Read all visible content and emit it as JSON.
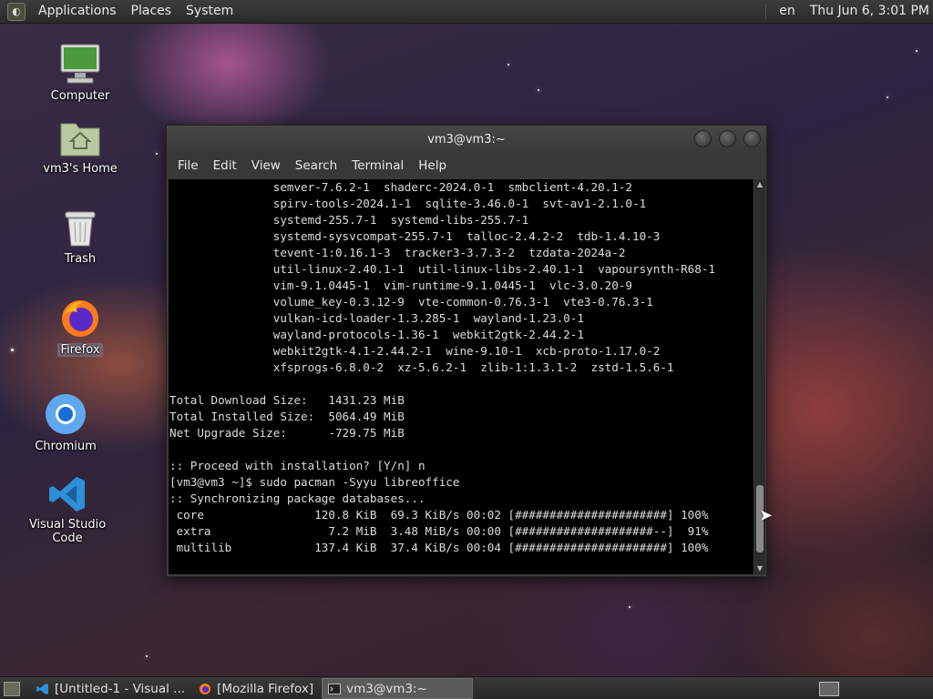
{
  "top_panel": {
    "menus": [
      "Applications",
      "Places",
      "System"
    ],
    "keyboard_layout": "en",
    "clock": "Thu Jun  6,  3:01 PM"
  },
  "desktop": {
    "icons": [
      {
        "label": "Computer",
        "icon": "computer-icon"
      },
      {
        "label": "vm3's Home",
        "icon": "home-folder-icon"
      },
      {
        "label": "Trash",
        "icon": "trash-icon"
      },
      {
        "label": "Firefox",
        "icon": "firefox-icon"
      },
      {
        "label": "Chromium",
        "icon": "chromium-icon"
      },
      {
        "label": "Visual Studio Code",
        "icon": "vscode-icon"
      }
    ]
  },
  "terminal": {
    "title": "vm3@vm3:~",
    "menu": [
      "File",
      "Edit",
      "View",
      "Search",
      "Terminal",
      "Help"
    ],
    "lines": [
      "               semver-7.6.2-1  shaderc-2024.0-1  smbclient-4.20.1-2",
      "               spirv-tools-2024.1-1  sqlite-3.46.0-1  svt-av1-2.1.0-1",
      "               systemd-255.7-1  systemd-libs-255.7-1",
      "               systemd-sysvcompat-255.7-1  talloc-2.4.2-2  tdb-1.4.10-3",
      "               tevent-1:0.16.1-3  tracker3-3.7.3-2  tzdata-2024a-2",
      "               util-linux-2.40.1-1  util-linux-libs-2.40.1-1  vapoursynth-R68-1",
      "               vim-9.1.0445-1  vim-runtime-9.1.0445-1  vlc-3.0.20-9",
      "               volume_key-0.3.12-9  vte-common-0.76.3-1  vte3-0.76.3-1",
      "               vulkan-icd-loader-1.3.285-1  wayland-1.23.0-1",
      "               wayland-protocols-1.36-1  webkit2gtk-2.44.2-1",
      "               webkit2gtk-4.1-2.44.2-1  wine-9.10-1  xcb-proto-1.17.0-2",
      "               xfsprogs-6.8.0-2  xz-5.6.2-1  zlib-1:1.3.1-2  zstd-1.5.6-1",
      "",
      "Total Download Size:   1431.23 MiB",
      "Total Installed Size:  5064.49 MiB",
      "Net Upgrade Size:      -729.75 MiB",
      "",
      ":: Proceed with installation? [Y/n] n",
      "[vm3@vm3 ~]$ sudo pacman -Syyu libreoffice",
      ":: Synchronizing package databases...",
      " core                120.8 KiB  69.3 KiB/s 00:02 [######################] 100%",
      " extra                 7.2 MiB  3.48 MiB/s 00:00 [####################--]  91%",
      " multilib            137.4 KiB  37.4 KiB/s 00:04 [######################] 100%"
    ]
  },
  "taskbar": {
    "tasks": [
      {
        "label": "[Untitled-1 - Visual ...",
        "icon": "vscode-icon",
        "active": false
      },
      {
        "label": "[Mozilla Firefox]",
        "icon": "firefox-icon",
        "active": false
      },
      {
        "label": "vm3@vm3:~",
        "icon": "terminal-icon",
        "active": true
      }
    ]
  }
}
